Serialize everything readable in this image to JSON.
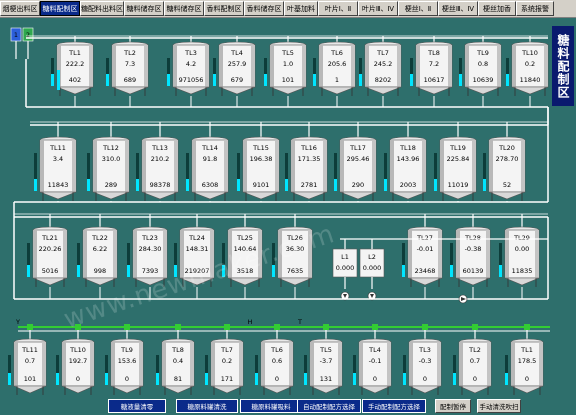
{
  "tabs": [
    {
      "label": "烟梗出料区",
      "active": false
    },
    {
      "label": "糖料配制区",
      "active": true
    },
    {
      "label": "糖配料出料区",
      "active": false
    },
    {
      "label": "糖料储存区",
      "active": false
    },
    {
      "label": "糖料储存区",
      "active": false
    },
    {
      "label": "香料配制区",
      "active": false
    },
    {
      "label": "香料储存区",
      "active": false
    },
    {
      "label": "叶基加料",
      "active": false
    },
    {
      "label": "叶片Ⅰ、Ⅱ",
      "active": false
    },
    {
      "label": "叶片Ⅲ、Ⅳ",
      "active": false
    },
    {
      "label": "梗丝Ⅰ、Ⅱ",
      "active": false
    },
    {
      "label": "梗丝Ⅲ、Ⅳ",
      "active": false
    },
    {
      "label": "梗丝加香",
      "active": false
    },
    {
      "label": "系统报警",
      "active": false
    }
  ],
  "area_title": "糖料配制区",
  "watermark": "www.newmaker.com",
  "left_indicators": [
    "1",
    "2"
  ],
  "row1_tanks": [
    {
      "name": "TL1",
      "v1": "222.2",
      "v2": "402"
    },
    {
      "name": "TL2",
      "v1": "7.3",
      "v2": "689"
    },
    {
      "name": "TL3",
      "v1": "4.2",
      "v2": "971056"
    },
    {
      "name": "TL4",
      "v1": "257.9",
      "v2": "679"
    },
    {
      "name": "TL5",
      "v1": "1.0",
      "v2": "101"
    },
    {
      "name": "TL6",
      "v1": "205.6",
      "v2": "1"
    },
    {
      "name": "TL7",
      "v1": "245.2",
      "v2": "8202"
    },
    {
      "name": "TL8",
      "v1": "7.2",
      "v2": "10617"
    },
    {
      "name": "TL9",
      "v1": "0.8",
      "v2": "10639"
    },
    {
      "name": "TL10",
      "v1": "0.2",
      "v2": "11840"
    }
  ],
  "row2_tanks": [
    {
      "name": "TL11",
      "v1": "3.4",
      "v2": "11843"
    },
    {
      "name": "TL12",
      "v1": "310.0",
      "v2": "289"
    },
    {
      "name": "TL13",
      "v1": "210.2",
      "v2": "98378"
    },
    {
      "name": "TL14",
      "v1": "91.8",
      "v2": "6308"
    },
    {
      "name": "TL15",
      "v1": "196.38",
      "v2": "9101"
    },
    {
      "name": "TL16",
      "v1": "171.35",
      "v2": "2781"
    },
    {
      "name": "TL17",
      "v1": "295.46",
      "v2": "290"
    },
    {
      "name": "TL18",
      "v1": "143.96",
      "v2": "2003"
    },
    {
      "name": "TL19",
      "v1": "225.84",
      "v2": "11019"
    },
    {
      "name": "TL20",
      "v1": "278.70",
      "v2": "52"
    }
  ],
  "row3_tanks": [
    {
      "name": "TL21",
      "v1": "220.26",
      "v2": "5016"
    },
    {
      "name": "TL22",
      "v1": "6.22",
      "v2": "998"
    },
    {
      "name": "TL23",
      "v1": "284.30",
      "v2": "7393"
    },
    {
      "name": "TL24",
      "v1": "148.31",
      "v2": "219207"
    },
    {
      "name": "TL25",
      "v1": "140.64",
      "v2": "3518"
    },
    {
      "name": "TL26",
      "v1": "36.30",
      "v2": "7635"
    },
    {
      "name": "TL27",
      "v1": "-0.01",
      "v2": "23468"
    },
    {
      "name": "TL28",
      "v1": "-0.38",
      "v2": "60139"
    },
    {
      "name": "TL29",
      "v1": "0.00",
      "v2": "11835"
    }
  ],
  "mixers": [
    {
      "name": "L1",
      "value": "0.000"
    },
    {
      "name": "L2",
      "value": "0.000"
    }
  ],
  "row4_tanks": [
    {
      "name": "TL11",
      "v1": "0.7",
      "v2": "101"
    },
    {
      "name": "TL10",
      "v1": "192.7",
      "v2": "0"
    },
    {
      "name": "TL9",
      "v1": "153.6",
      "v2": "0"
    },
    {
      "name": "TL8",
      "v1": "0.4",
      "v2": "81"
    },
    {
      "name": "TL7",
      "v1": "0.2",
      "v2": "171"
    },
    {
      "name": "TL6",
      "v1": "0.6",
      "v2": "0"
    },
    {
      "name": "TL5",
      "v1": "-3.7",
      "v2": "131"
    },
    {
      "name": "TL4",
      "v1": "-0.1",
      "v2": "0"
    },
    {
      "name": "TL3",
      "v1": "-0.3",
      "v2": "0"
    },
    {
      "name": "TL2",
      "v1": "0.7",
      "v2": "0"
    },
    {
      "name": "TL1",
      "v1": "178.5",
      "v2": "0"
    }
  ],
  "pipe_labels": {
    "y": "Y",
    "h": "H",
    "t": "T"
  },
  "buttons": [
    {
      "label": "糖液量清零",
      "style": "blue"
    },
    {
      "label": "糖原料罐清洗",
      "style": "blue"
    },
    {
      "label": "糖原料罐吸料",
      "style": "blue"
    },
    {
      "label": "自动配制配方选择",
      "style": "blue"
    },
    {
      "label": "手动配制配方选择",
      "style": "blue"
    },
    {
      "label": "配制暂停",
      "style": "gray"
    },
    {
      "label": "手动清洗吹扫",
      "style": "gray"
    }
  ],
  "colors": {
    "background": "#2e6f6c",
    "pipe": "#ffffff",
    "green_pipe": "#33cc33",
    "level_bar": "#00e5ff",
    "tank_face": "#ffffff"
  }
}
